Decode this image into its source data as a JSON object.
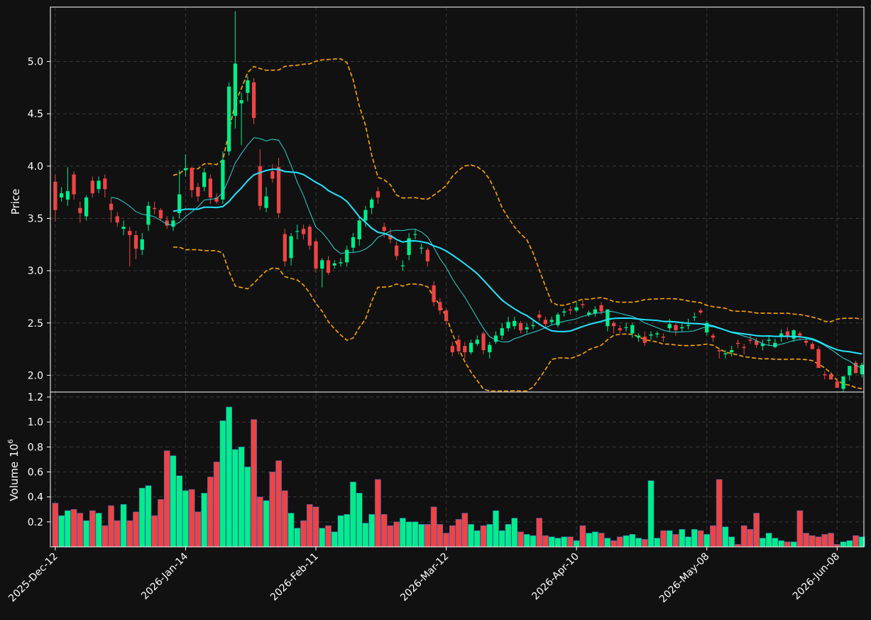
{
  "chart_data": {
    "type": "candlestick",
    "colors": {
      "up": "#00ee88",
      "down": "#ee4444",
      "ma_fast": "#2fd3d3",
      "ma_slow": "#22e5ff",
      "bands": "#ffa500",
      "background": "#111111",
      "grid": "#3a3a3a"
    },
    "price_axis": {
      "label": "Price",
      "ylim": [
        1.84,
        5.52
      ],
      "ticks": [
        "2.0",
        "2.5",
        "3.0",
        "3.5",
        "4.0",
        "4.5",
        "5.0"
      ]
    },
    "volume_axis": {
      "label": "Volume",
      "exponent_label": "10",
      "exponent": "6",
      "ylim": [
        0,
        1.24
      ],
      "ticks": [
        "0.2",
        "0.4",
        "0.6",
        "0.8",
        "1.0",
        "1.2"
      ]
    },
    "x_ticks": [
      {
        "index": 0,
        "label": "2025-Dec-12"
      },
      {
        "index": 21,
        "label": "2026-Jan-14"
      },
      {
        "index": 42,
        "label": "2026-Feb-11"
      },
      {
        "index": 63,
        "label": "2026-Mar-12"
      },
      {
        "index": 84,
        "label": "2026-Apr-10"
      },
      {
        "index": 105,
        "label": "2026-May-08"
      },
      {
        "index": 126,
        "label": "2026-Jun-08"
      }
    ],
    "n_bars": 131,
    "grid": true,
    "ohlc_close": [
      3.58,
      3.74,
      3.76,
      3.73,
      3.55,
      3.7,
      3.74,
      3.86,
      3.78,
      3.58,
      3.46,
      3.42,
      3.34,
      3.21,
      3.3,
      3.62,
      3.59,
      3.5,
      3.43,
      3.48,
      3.73,
      3.98,
      3.77,
      3.71,
      3.94,
      3.7,
      3.66,
      4.06,
      4.76,
      4.98,
      4.63,
      4.82,
      4.46,
      3.62,
      3.71,
      3.88,
      3.55,
      3.09,
      3.33,
      3.38,
      3.35,
      3.24,
      3.02,
      3.1,
      2.98,
      3.07,
      3.08,
      3.2,
      3.32,
      3.48,
      3.58,
      3.68,
      3.7,
      3.38,
      3.3,
      3.14,
      3.05,
      3.31,
      3.35,
      3.22,
      3.09,
      2.7,
      2.62,
      2.52,
      2.22,
      2.23,
      2.22,
      2.31,
      2.34,
      2.24,
      2.29,
      2.38,
      2.45,
      2.51,
      2.52,
      2.43,
      2.46,
      2.48,
      2.55,
      2.49,
      2.53,
      2.58,
      2.61,
      2.62,
      2.65,
      2.67,
      2.6,
      2.63,
      2.61,
      2.63,
      2.47,
      2.43,
      2.46,
      2.48,
      2.38,
      2.31,
      2.39,
      2.4,
      2.36,
      2.49,
      2.43,
      2.46,
      2.48,
      2.56,
      2.6,
      2.5,
      2.36,
      2.23,
      2.21,
      2.24,
      2.3,
      2.26,
      2.33,
      2.29,
      2.3,
      2.34,
      2.31,
      2.4,
      2.37,
      2.43,
      2.38,
      2.31,
      2.25,
      2.07,
      2.0,
      1.96,
      1.88,
      1.99,
      2.09,
      2.02,
      2.1
    ],
    "ohlc_open": [
      3.85,
      3.7,
      3.68,
      3.92,
      3.6,
      3.52,
      3.86,
      3.78,
      3.88,
      3.64,
      3.52,
      3.4,
      3.38,
      3.34,
      3.2,
      3.44,
      3.6,
      3.58,
      3.48,
      3.42,
      3.55,
      3.96,
      3.98,
      3.8,
      3.8,
      3.88,
      3.7,
      3.68,
      4.14,
      4.48,
      4.6,
      4.7,
      4.8,
      4.0,
      3.6,
      3.95,
      3.99,
      3.35,
      3.12,
      3.38,
      3.4,
      3.42,
      3.28,
      3.02,
      3.1,
      3.05,
      3.07,
      3.08,
      3.22,
      3.3,
      3.48,
      3.6,
      3.76,
      3.42,
      3.34,
      3.24,
      3.05,
      3.15,
      3.35,
      3.22,
      3.2,
      2.86,
      2.7,
      2.62,
      2.28,
      2.34,
      2.28,
      2.22,
      2.3,
      2.4,
      2.22,
      2.32,
      2.38,
      2.45,
      2.47,
      2.5,
      2.44,
      2.47,
      2.58,
      2.53,
      2.51,
      2.48,
      2.6,
      2.63,
      2.62,
      2.68,
      2.58,
      2.59,
      2.67,
      2.47,
      2.5,
      2.45,
      2.46,
      2.4,
      2.36,
      2.37,
      2.38,
      2.39,
      2.37,
      2.45,
      2.48,
      2.45,
      2.48,
      2.56,
      2.62,
      2.41,
      2.38,
      2.24,
      2.2,
      2.22,
      2.31,
      2.27,
      2.34,
      2.33,
      2.28,
      2.33,
      2.27,
      2.37,
      2.42,
      2.35,
      2.4,
      2.33,
      2.3,
      2.25,
      2.01,
      2.01,
      1.94,
      1.87,
      2.0,
      2.12,
      2.01
    ],
    "ohlc_high": [
      3.92,
      3.8,
      3.99,
      3.95,
      3.66,
      3.72,
      3.9,
      3.9,
      3.92,
      3.7,
      3.56,
      3.48,
      3.42,
      3.38,
      3.36,
      3.66,
      3.66,
      3.6,
      3.52,
      3.52,
      3.96,
      4.11,
      3.99,
      3.84,
      3.98,
      3.92,
      3.74,
      4.14,
      4.8,
      5.48,
      4.7,
      4.86,
      4.84,
      4.16,
      3.8,
      4.02,
      4.08,
      3.4,
      3.36,
      3.44,
      3.44,
      3.44,
      3.3,
      3.12,
      3.14,
      3.1,
      3.12,
      3.24,
      3.36,
      3.52,
      3.62,
      3.7,
      3.8,
      3.46,
      3.4,
      3.28,
      3.1,
      3.36,
      3.4,
      3.26,
      3.22,
      2.9,
      2.74,
      2.64,
      2.32,
      2.38,
      2.32,
      2.34,
      2.38,
      2.42,
      2.32,
      2.42,
      2.5,
      2.56,
      2.56,
      2.52,
      2.5,
      2.52,
      2.62,
      2.56,
      2.56,
      2.6,
      2.64,
      2.66,
      2.7,
      2.72,
      2.62,
      2.66,
      2.7,
      2.52,
      2.52,
      2.48,
      2.5,
      2.5,
      2.4,
      2.42,
      2.42,
      2.42,
      2.4,
      2.54,
      2.5,
      2.5,
      2.54,
      2.6,
      2.64,
      2.52,
      2.4,
      2.26,
      2.24,
      2.28,
      2.34,
      2.3,
      2.38,
      2.36,
      2.34,
      2.38,
      2.35,
      2.44,
      2.46,
      2.44,
      2.42,
      2.36,
      2.32,
      2.28,
      2.04,
      2.03,
      1.97,
      1.91,
      2.03,
      2.14,
      2.12
    ],
    "ohlc_low": [
      3.47,
      3.66,
      3.62,
      3.68,
      3.46,
      3.48,
      3.7,
      3.74,
      3.7,
      3.46,
      3.42,
      3.34,
      3.04,
      3.11,
      3.15,
      3.38,
      3.54,
      3.48,
      3.4,
      3.38,
      3.5,
      3.9,
      3.7,
      3.66,
      3.76,
      3.64,
      3.64,
      3.64,
      4.1,
      4.36,
      4.2,
      4.62,
      4.4,
      3.58,
      3.56,
      3.84,
      3.5,
      3.04,
      3.05,
      3.3,
      3.3,
      3.2,
      2.98,
      2.84,
      2.96,
      3.02,
      3.04,
      3.04,
      3.18,
      3.24,
      3.42,
      3.54,
      3.64,
      3.32,
      3.26,
      3.1,
      3.0,
      3.1,
      3.3,
      3.16,
      3.04,
      2.66,
      2.58,
      2.48,
      2.18,
      2.2,
      2.16,
      2.2,
      2.28,
      2.2,
      2.16,
      2.3,
      2.34,
      2.42,
      2.44,
      2.4,
      2.4,
      2.44,
      2.52,
      2.46,
      2.48,
      2.46,
      2.56,
      2.58,
      2.6,
      2.64,
      2.56,
      2.56,
      2.58,
      2.42,
      2.4,
      2.4,
      2.42,
      2.36,
      2.32,
      2.28,
      2.34,
      2.36,
      2.32,
      2.42,
      2.38,
      2.42,
      2.44,
      2.52,
      2.58,
      2.38,
      2.32,
      2.16,
      2.16,
      2.18,
      2.26,
      2.2,
      2.3,
      2.26,
      2.24,
      2.28,
      2.26,
      2.32,
      2.34,
      2.32,
      2.34,
      2.28,
      2.28,
      2.2,
      1.96,
      1.96,
      1.9,
      1.84,
      1.95,
      2.04,
      1.98
    ],
    "ma_fast_values": "computed",
    "volume_values": [
      0.35,
      0.25,
      0.29,
      0.3,
      0.27,
      0.21,
      0.29,
      0.27,
      0.17,
      0.33,
      0.21,
      0.34,
      0.21,
      0.28,
      0.47,
      0.49,
      0.25,
      0.38,
      0.77,
      0.73,
      0.57,
      0.45,
      0.46,
      0.28,
      0.43,
      0.56,
      0.68,
      1.01,
      1.12,
      0.78,
      0.8,
      0.64,
      1.02,
      0.4,
      0.37,
      0.6,
      0.69,
      0.45,
      0.27,
      0.15,
      0.21,
      0.34,
      0.32,
      0.15,
      0.17,
      0.12,
      0.25,
      0.26,
      0.52,
      0.43,
      0.19,
      0.26,
      0.54,
      0.26,
      0.17,
      0.2,
      0.23,
      0.2,
      0.2,
      0.18,
      0.18,
      0.32,
      0.18,
      0.11,
      0.17,
      0.22,
      0.27,
      0.18,
      0.13,
      0.17,
      0.18,
      0.29,
      0.13,
      0.18,
      0.23,
      0.12,
      0.1,
      0.09,
      0.23,
      0.09,
      0.08,
      0.07,
      0.08,
      0.08,
      0.05,
      0.17,
      0.11,
      0.12,
      0.11,
      0.07,
      0.05,
      0.08,
      0.09,
      0.1,
      0.07,
      0.06,
      0.53,
      0.07,
      0.13,
      0.13,
      0.1,
      0.14,
      0.08,
      0.14,
      0.13,
      0.1,
      0.17,
      0.54,
      0.16,
      0.08,
      0.02,
      0.17,
      0.14,
      0.27,
      0.07,
      0.11,
      0.07,
      0.05,
      0.04,
      0.04,
      0.29,
      0.11,
      0.09,
      0.08,
      0.1,
      0.11,
      0.02,
      0.04,
      0.05,
      0.09,
      0.08
    ]
  }
}
